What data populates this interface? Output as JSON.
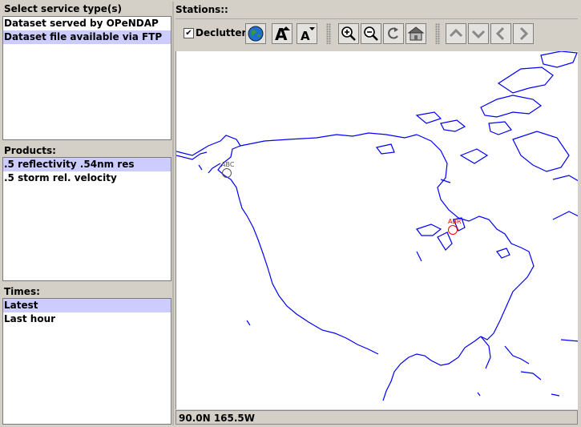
{
  "service_types": {
    "title": "Select service type(s)",
    "items": [
      {
        "label": "Dataset served by OPeNDAP",
        "selected": false
      },
      {
        "label": "Dataset file available via FTP",
        "selected": true
      }
    ]
  },
  "products": {
    "title": "Products:",
    "items": [
      {
        "label": ".5 reflectivity .54nm res",
        "selected": true
      },
      {
        "label": ".5 storm rel. velocity",
        "selected": false
      }
    ]
  },
  "times": {
    "title": "Times:",
    "items": [
      {
        "label": "Latest",
        "selected": true
      },
      {
        "label": "Last hour",
        "selected": false
      }
    ]
  },
  "stations": {
    "title": "Stations::",
    "declutter_label": "Declutter",
    "declutter_checked": true,
    "toolbar_icons": [
      "globe-icon",
      "font-larger-icon",
      "font-smaller-icon",
      "zoom-in-icon",
      "zoom-out-icon",
      "reset-icon",
      "home-icon",
      "pan-up-icon",
      "pan-down-icon",
      "pan-left-icon",
      "pan-right-icon"
    ],
    "markers": [
      {
        "label": "ABC",
        "color": "#555555"
      },
      {
        "label": "ABR",
        "color": "#ff0000"
      }
    ],
    "map_line_color": "#0000ff"
  },
  "status": {
    "coords": "90.0N 165.5W"
  }
}
